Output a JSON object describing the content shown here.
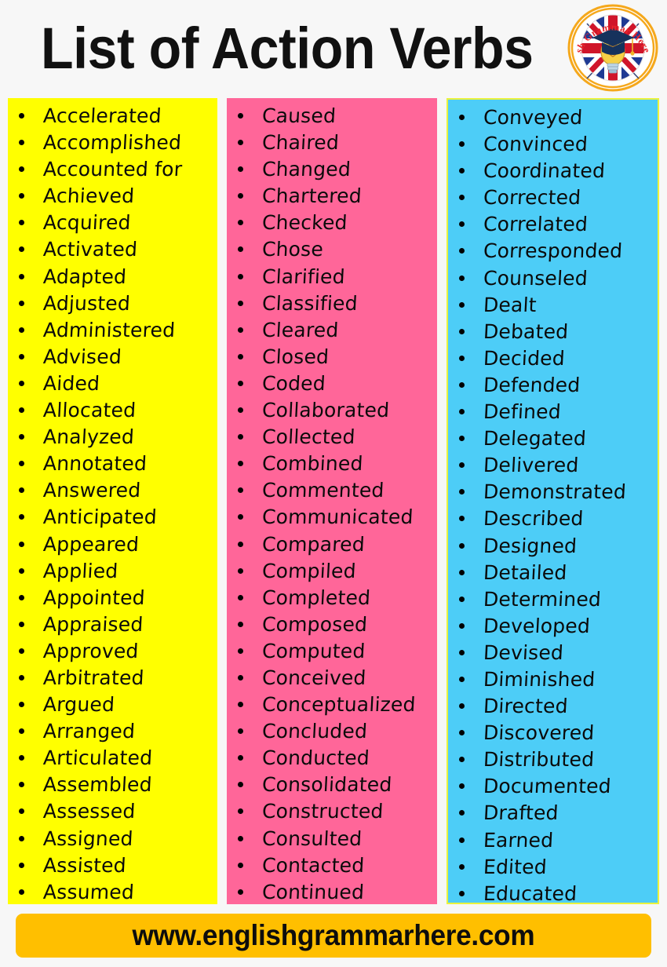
{
  "header": {
    "title": "List of Action Verbs",
    "logo": {
      "name": "english-grammar-here-logo",
      "text": "English Grammar Here.Com",
      "ring_color": "#f5a81c",
      "text_color": "#e8262b"
    }
  },
  "columns": [
    {
      "id": "column-1",
      "color": "#ffff00",
      "verbs": [
        "Accelerated",
        "Accomplished",
        "Accounted for",
        "Achieved",
        "Acquired",
        "Activated",
        "Adapted",
        "Adjusted",
        "Administered",
        "Advised",
        "Aided",
        "Allocated",
        "Analyzed",
        "Annotated",
        "Answered",
        "Anticipated",
        "Appeared",
        "Applied",
        "Appointed",
        "Appraised",
        "Approved",
        "Arbitrated",
        "Argued",
        "Arranged",
        "Articulated",
        "Assembled",
        "Assessed",
        "Assigned",
        "Assisted",
        "Assumed"
      ]
    },
    {
      "id": "column-2",
      "color": "#ff6699",
      "verbs": [
        "Caused",
        "Chaired",
        "Changed",
        "Chartered",
        "Checked",
        "Chose",
        "Clarified",
        "Classified",
        "Cleared",
        "Closed",
        "Coded",
        "Collaborated",
        "Collected",
        "Combined",
        "Commented",
        "Communicated",
        "Compared",
        "Compiled",
        "Completed",
        "Composed",
        "Computed",
        "Conceived",
        "Conceptualized",
        "Concluded",
        "Conducted",
        "Consolidated",
        "Constructed",
        "Consulted",
        "Contacted",
        "Continued"
      ]
    },
    {
      "id": "column-3",
      "color": "#4dcdf7",
      "verbs": [
        "Conveyed",
        "Convinced",
        "Coordinated",
        "Corrected",
        "Correlated",
        "Corresponded",
        "Counseled",
        "Dealt",
        "Debated",
        "Decided",
        "Defended",
        "Defined",
        "Delegated",
        "Delivered",
        "Demonstrated",
        "Described",
        "Designed",
        "Detailed",
        "Determined",
        "Developed",
        "Devised",
        "Diminished",
        "Directed",
        "Discovered",
        "Distributed",
        "Documented",
        "Drafted",
        "Earned",
        "Edited",
        "Educated"
      ]
    }
  ],
  "footer": {
    "url": "www.englishgrammarhere.com",
    "background": "#ffbf00"
  }
}
